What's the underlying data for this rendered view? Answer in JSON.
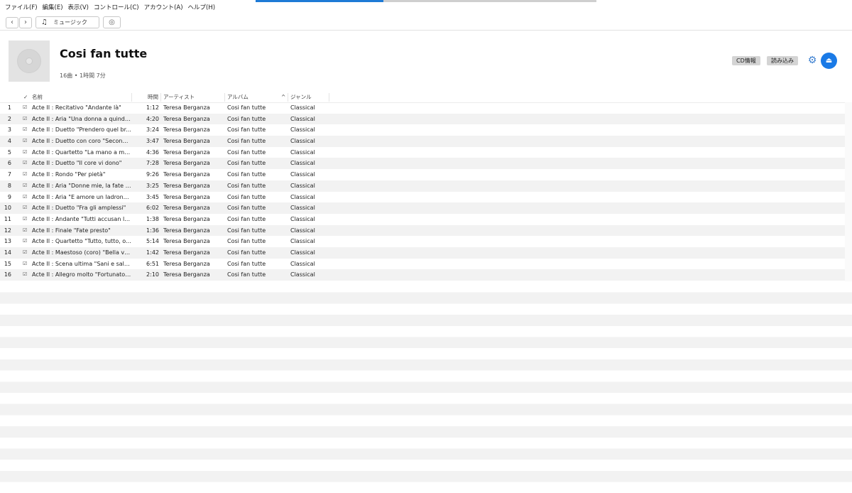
{
  "menu": [
    "ファイル(F)",
    "編集(E)",
    "表示(V)",
    "コントロール(C)",
    "アカウント(A)",
    "ヘルプ(H)"
  ],
  "toolbar": {
    "back_icon": "‹",
    "forward_icon": "›",
    "library_icon": "♫",
    "library_label": "ミュージック",
    "radio_icon": "◎"
  },
  "progress": {
    "fraction": 0.375
  },
  "album": {
    "title": "Cosi fan tutte",
    "subtitle": "16曲 • 1時間 7分"
  },
  "actions": {
    "cd_info": "CD情報",
    "import": "読み込み",
    "gear_icon": "⚙",
    "eject_icon": "⏏"
  },
  "columns": {
    "check": "✓",
    "name": "名前",
    "time": "時間",
    "artist": "アーティスト",
    "album": "アルバム",
    "sort_indicator": "^",
    "genre": "ジャンル"
  },
  "tracks": [
    {
      "num": "1",
      "check": "☑",
      "name": "Acte II : Recitativo \"Andante là\"",
      "time": "1:12",
      "artist": "Teresa Berganza",
      "album": "Cosi fan tutte",
      "genre": "Classical"
    },
    {
      "num": "2",
      "check": "☑",
      "name": "Acte II : Aria \"Una donna a quindic...",
      "time": "4:20",
      "artist": "Teresa Berganza",
      "album": "Cosi fan tutte",
      "genre": "Classical"
    },
    {
      "num": "3",
      "check": "☑",
      "name": "Acte II : Duetto \"Prendero quel br...",
      "time": "3:24",
      "artist": "Teresa Berganza",
      "album": "Cosi fan tutte",
      "genre": "Classical"
    },
    {
      "num": "4",
      "check": "☑",
      "name": "Acte II : Duetto con coro \"Seconda...",
      "time": "3:47",
      "artist": "Teresa Berganza",
      "album": "Cosi fan tutte",
      "genre": "Classical"
    },
    {
      "num": "5",
      "check": "☑",
      "name": "Acte II : Quartetto \"La mano a me...",
      "time": "4:36",
      "artist": "Teresa Berganza",
      "album": "Cosi fan tutte",
      "genre": "Classical"
    },
    {
      "num": "6",
      "check": "☑",
      "name": "Acte II : Duetto \"Il core vi dono\"",
      "time": "7:28",
      "artist": "Teresa Berganza",
      "album": "Cosi fan tutte",
      "genre": "Classical"
    },
    {
      "num": "7",
      "check": "☑",
      "name": "Acte II : Rondo \"Per pietà\"",
      "time": "9:26",
      "artist": "Teresa Berganza",
      "album": "Cosi fan tutte",
      "genre": "Classical"
    },
    {
      "num": "8",
      "check": "☑",
      "name": "Acte II : Aria \"Donne mie, la fate a...",
      "time": "3:25",
      "artist": "Teresa Berganza",
      "album": "Cosi fan tutte",
      "genre": "Classical"
    },
    {
      "num": "9",
      "check": "☑",
      "name": "Acte II : Aria \"E amore un ladronce...",
      "time": "3:45",
      "artist": "Teresa Berganza",
      "album": "Cosi fan tutte",
      "genre": "Classical"
    },
    {
      "num": "10",
      "check": "☑",
      "name": "Acte II : Duetto \"Fra gli amplessi\"",
      "time": "6:02",
      "artist": "Teresa Berganza",
      "album": "Cosi fan tutte",
      "genre": "Classical"
    },
    {
      "num": "11",
      "check": "☑",
      "name": "Acte II : Andante \"Tutti accusan le...",
      "time": "1:38",
      "artist": "Teresa Berganza",
      "album": "Cosi fan tutte",
      "genre": "Classical"
    },
    {
      "num": "12",
      "check": "☑",
      "name": "Acte II : Finale \"Fate presto\"",
      "time": "1:36",
      "artist": "Teresa Berganza",
      "album": "Cosi fan tutte",
      "genre": "Classical"
    },
    {
      "num": "13",
      "check": "☑",
      "name": "Acte II : Quartetto \"Tutto, tutto, o...",
      "time": "5:14",
      "artist": "Teresa Berganza",
      "album": "Cosi fan tutte",
      "genre": "Classical"
    },
    {
      "num": "14",
      "check": "☑",
      "name": "Acte II : Maestoso (coro) \"Bella vit...",
      "time": "1:42",
      "artist": "Teresa Berganza",
      "album": "Cosi fan tutte",
      "genre": "Classical"
    },
    {
      "num": "15",
      "check": "☑",
      "name": "Acte II : Scena ultima \"Sani e salvi\"",
      "time": "6:51",
      "artist": "Teresa Berganza",
      "album": "Cosi fan tutte",
      "genre": "Classical"
    },
    {
      "num": "16",
      "check": "☑",
      "name": "Acte II : Allegro molto \"Fortunato l...",
      "time": "2:10",
      "artist": "Teresa Berganza",
      "album": "Cosi fan tutte",
      "genre": "Classical"
    }
  ]
}
